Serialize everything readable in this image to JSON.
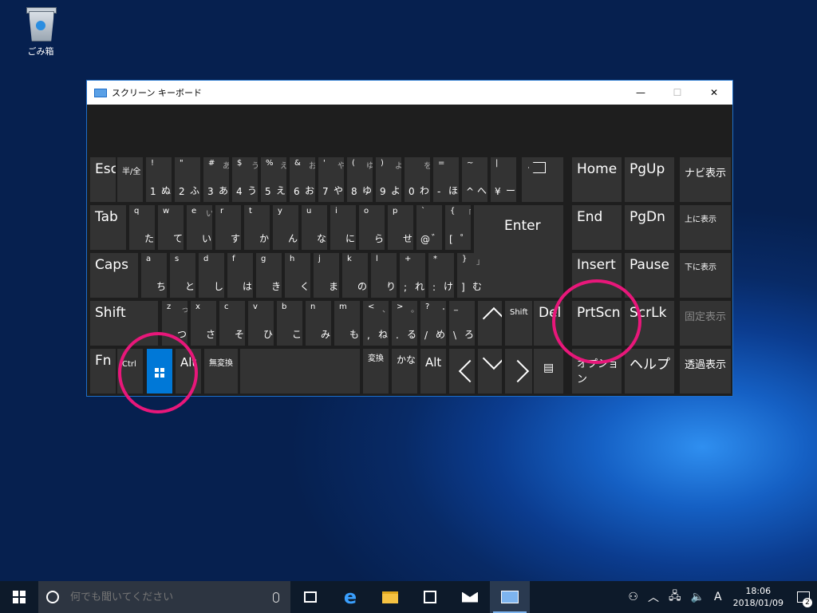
{
  "desktop": {
    "recycle_bin_label": "ごみ箱"
  },
  "window": {
    "title": "スクリーン キーボード",
    "minimize": "—",
    "maximize": "☐",
    "close": "✕"
  },
  "keys": {
    "esc": "Esc",
    "hankaku": "半/全",
    "tab": "Tab",
    "caps": "Caps",
    "shift": "Shift",
    "enter": "Enter",
    "fn": "Fn",
    "ctrl": "Ctrl",
    "alt": "Alt",
    "alt_right": "Alt",
    "muhenkan": "無変換",
    "henkan": "変換",
    "kana": "かな",
    "shift_right": "Shift",
    "del": "Del",
    "home": "Home",
    "pgup": "PgUp",
    "nav_show": "ナビ表示",
    "end": "End",
    "pgdn": "PgDn",
    "move_up": "上に表示",
    "insert": "Insert",
    "pause": "Pause",
    "move_down": "下に表示",
    "prtscn": "PrtScn",
    "scrlk": "ScrLk",
    "fix_show": "固定表示",
    "options": "オプション",
    "help": "ヘルプ",
    "transparent": "透過表示",
    "row1": [
      {
        "t": "!",
        "tr": "",
        "b1": "1",
        "b2": "ぬ"
      },
      {
        "t": "\"",
        "tr": "",
        "b1": "2",
        "b2": "ふ"
      },
      {
        "t": "#",
        "tr": "あ",
        "b1": "3",
        "b2": "あ"
      },
      {
        "t": "$",
        "tr": "う",
        "b1": "4",
        "b2": "う"
      },
      {
        "t": "%",
        "tr": "え",
        "b1": "5",
        "b2": "え"
      },
      {
        "t": "&",
        "tr": "お",
        "b1": "6",
        "b2": "お"
      },
      {
        "t": "'",
        "tr": "や",
        "b1": "7",
        "b2": "や"
      },
      {
        "t": "(",
        "tr": "ゆ",
        "b1": "8",
        "b2": "ゆ"
      },
      {
        "t": ")",
        "tr": "よ",
        "b1": "9",
        "b2": "よ"
      },
      {
        "t": "",
        "tr": "を",
        "b1": "0",
        "b2": "わ"
      },
      {
        "t": "=",
        "tr": "",
        "b1": "-",
        "b2": "ほ"
      },
      {
        "t": "~",
        "tr": "",
        "b1": "^",
        "b2": "へ"
      },
      {
        "t": "|",
        "tr": "",
        "b1": "¥",
        "b2": "ー"
      }
    ],
    "row2": [
      {
        "t": "q",
        "tr": "",
        "b1": "",
        "b2": "た"
      },
      {
        "t": "w",
        "tr": "",
        "b1": "",
        "b2": "て"
      },
      {
        "t": "e",
        "tr": "い",
        "b1": "",
        "b2": "い"
      },
      {
        "t": "r",
        "tr": "",
        "b1": "",
        "b2": "す"
      },
      {
        "t": "t",
        "tr": "",
        "b1": "",
        "b2": "か"
      },
      {
        "t": "y",
        "tr": "",
        "b1": "",
        "b2": "ん"
      },
      {
        "t": "u",
        "tr": "",
        "b1": "",
        "b2": "な"
      },
      {
        "t": "i",
        "tr": "",
        "b1": "",
        "b2": "に"
      },
      {
        "t": "o",
        "tr": "",
        "b1": "",
        "b2": "ら"
      },
      {
        "t": "p",
        "tr": "",
        "b1": "",
        "b2": "せ"
      },
      {
        "t": "`",
        "tr": "",
        "b1": "@",
        "b2": "゛"
      },
      {
        "t": "{",
        "tr": "「",
        "b1": "[",
        "b2": "゜"
      }
    ],
    "row3": [
      {
        "t": "a",
        "tr": "",
        "b1": "",
        "b2": "ち"
      },
      {
        "t": "s",
        "tr": "",
        "b1": "",
        "b2": "と"
      },
      {
        "t": "d",
        "tr": "",
        "b1": "",
        "b2": "し"
      },
      {
        "t": "f",
        "tr": "",
        "b1": "",
        "b2": "は"
      },
      {
        "t": "g",
        "tr": "",
        "b1": "",
        "b2": "き"
      },
      {
        "t": "h",
        "tr": "",
        "b1": "",
        "b2": "く"
      },
      {
        "t": "j",
        "tr": "",
        "b1": "",
        "b2": "ま"
      },
      {
        "t": "k",
        "tr": "",
        "b1": "",
        "b2": "の"
      },
      {
        "t": "l",
        "tr": "",
        "b1": "",
        "b2": "り"
      },
      {
        "t": "+",
        "tr": "",
        "b1": ";",
        "b2": "れ"
      },
      {
        "t": "*",
        "tr": "",
        "b1": ":",
        "b2": "け"
      },
      {
        "t": "}",
        "tr": "」",
        "b1": "]",
        "b2": "む"
      }
    ],
    "row4": [
      {
        "t": "z",
        "tr": "っ",
        "b1": "",
        "b2": "つ"
      },
      {
        "t": "x",
        "tr": "",
        "b1": "",
        "b2": "さ"
      },
      {
        "t": "c",
        "tr": "",
        "b1": "",
        "b2": "そ"
      },
      {
        "t": "v",
        "tr": "",
        "b1": "",
        "b2": "ひ"
      },
      {
        "t": "b",
        "tr": "",
        "b1": "",
        "b2": "こ"
      },
      {
        "t": "n",
        "tr": "",
        "b1": "",
        "b2": "み"
      },
      {
        "t": "m",
        "tr": "",
        "b1": "",
        "b2": "も"
      },
      {
        "t": "<",
        "tr": "、",
        "b1": ",",
        "b2": "ね"
      },
      {
        "t": ">",
        "tr": "。",
        "b1": ".",
        "b2": "る"
      },
      {
        "t": "?",
        "tr": "・",
        "b1": "/",
        "b2": "め"
      },
      {
        "t": "_",
        "tr": "",
        "b1": "\\",
        "b2": "ろ"
      }
    ]
  },
  "taskbar": {
    "search_placeholder": "何でも聞いてください",
    "ime": "A",
    "time": "18:06",
    "date": "2018/01/09",
    "notifications": "2"
  },
  "annotations": {
    "color": "#e8177a"
  }
}
